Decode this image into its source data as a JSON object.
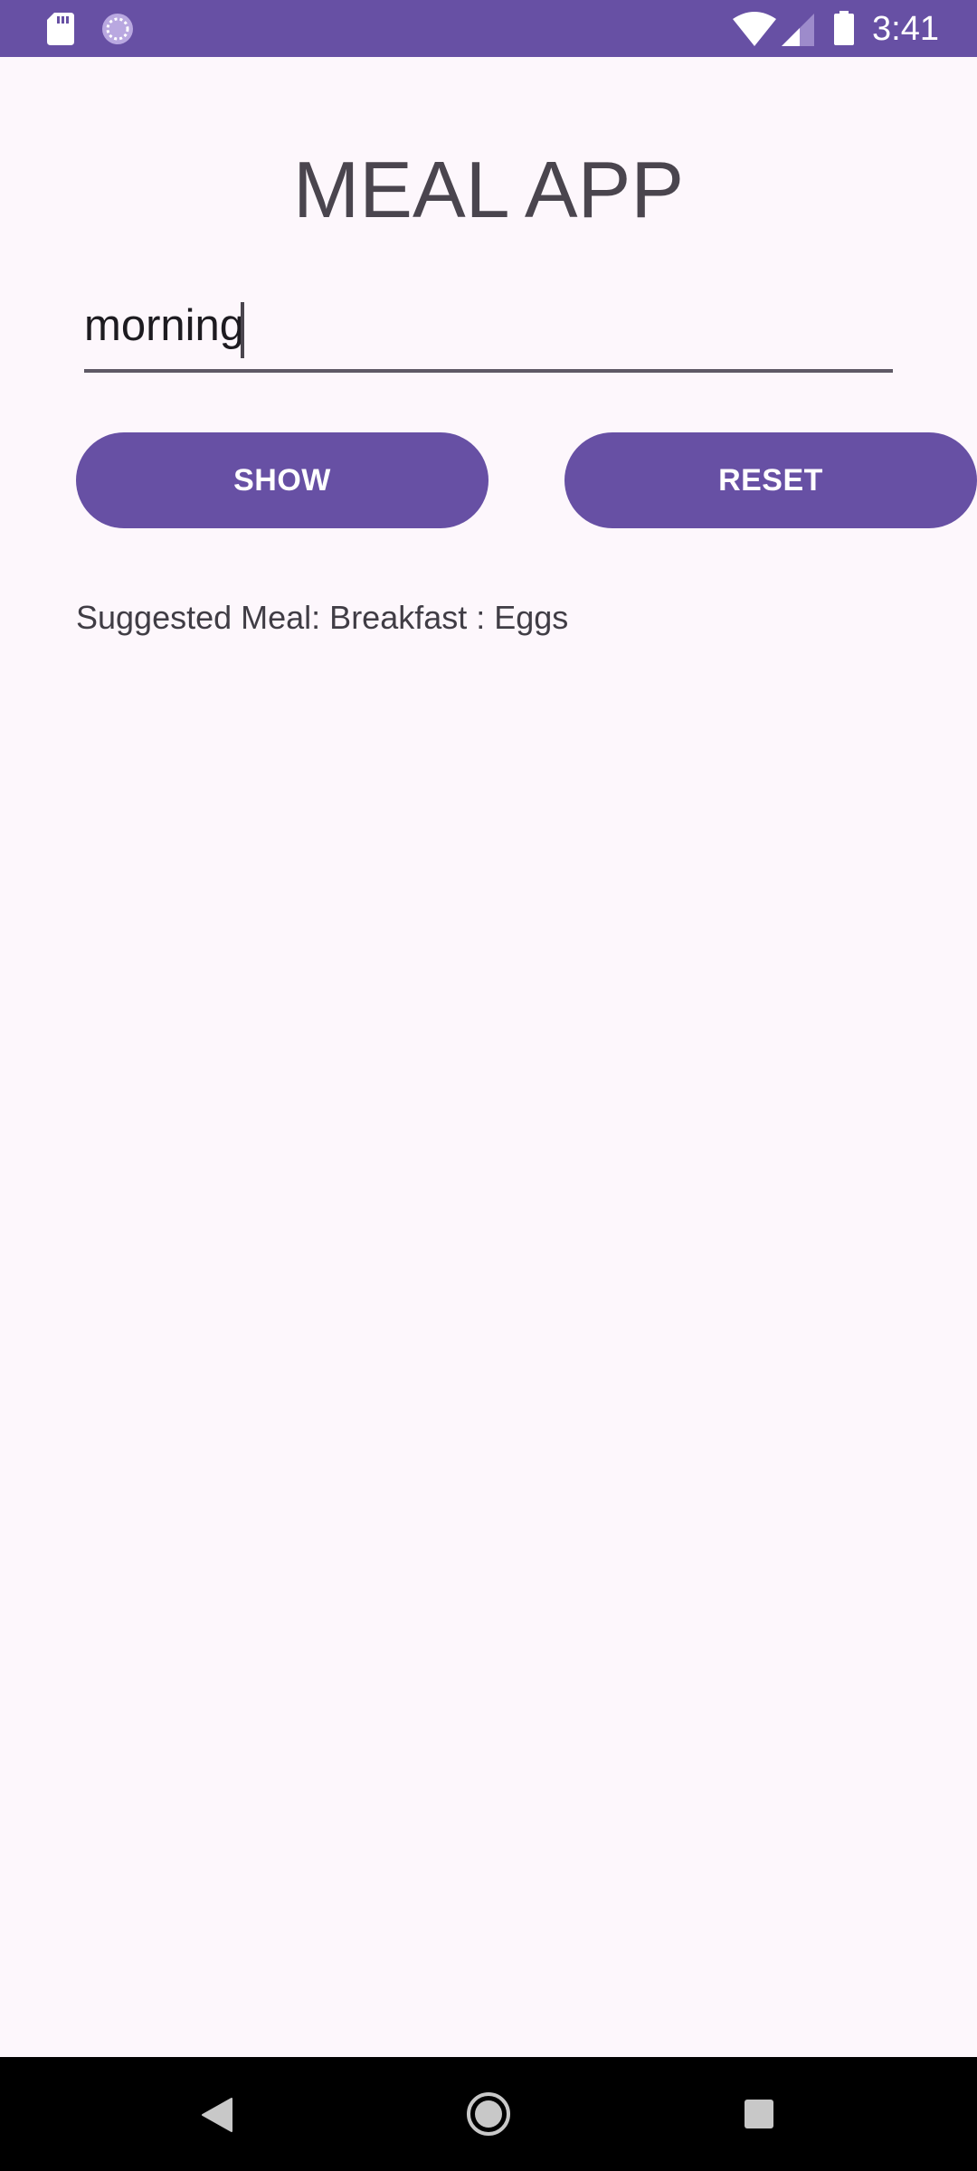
{
  "status_bar": {
    "time": "3:41",
    "icons": [
      "sd-card-icon",
      "sync-icon",
      "wifi-icon",
      "signal-icon",
      "battery-icon"
    ],
    "background": "#6750a4"
  },
  "app": {
    "title": "MEAL APP",
    "input": {
      "value": "morning",
      "placeholder": ""
    },
    "buttons": {
      "show_label": "SHOW",
      "reset_label": "RESET"
    },
    "suggestion": "Suggested Meal: Breakfast : Eggs"
  },
  "nav_bar": {
    "icons": [
      "back-icon",
      "home-icon",
      "recents-icon"
    ]
  },
  "colors": {
    "accent": "#6750a4",
    "background": "#fdf7fc",
    "title_text": "#4a454e"
  }
}
